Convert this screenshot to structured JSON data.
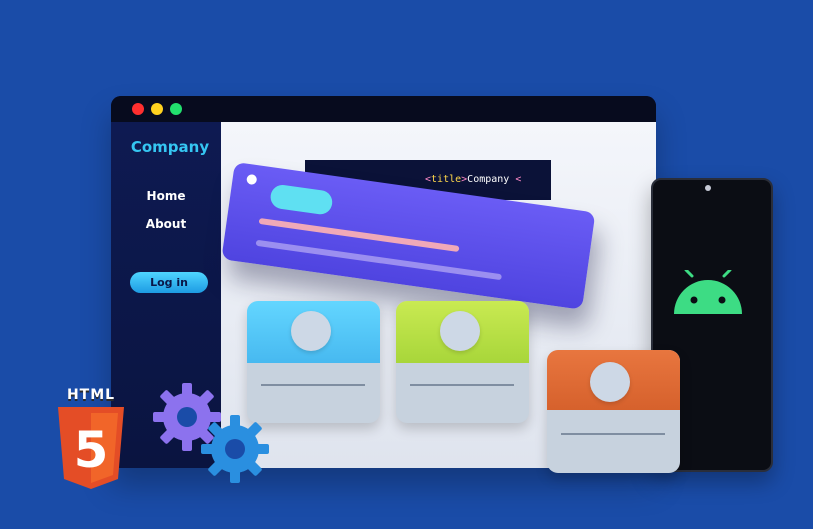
{
  "browser": {
    "window_controls": [
      "close",
      "minimize",
      "maximize"
    ],
    "brand": "Company",
    "nav": {
      "home": "Home",
      "about": "About"
    },
    "login_label": "Log in",
    "code": {
      "open_bracket": "<",
      "tag": "title",
      "close_bracket": ">",
      "text": "Company",
      "trailing": "<"
    }
  },
  "badges": {
    "html5_word": "HTML",
    "html5_number": "5"
  },
  "icons": [
    "android-icon",
    "gear-icon",
    "html5-icon"
  ],
  "colors": {
    "background": "#1a4ca8",
    "brand": "#35c6f2",
    "login": "#1d9be3",
    "hero_card": "#5b4ff0",
    "card_blue": "#55c8f8",
    "card_lime": "#b8e046",
    "card_orange": "#e06a34",
    "android": "#3ddc84",
    "html5": "#e44d26"
  }
}
